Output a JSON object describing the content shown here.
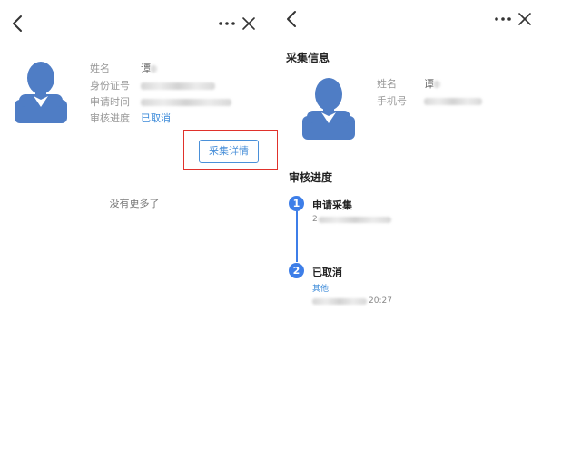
{
  "left_panel": {
    "labels": {
      "name": "姓名",
      "id_number": "身份证号",
      "apply_time": "申请时间",
      "review_progress": "审核进度"
    },
    "values": {
      "name_visible": "谭",
      "review_status": "已取消"
    },
    "detail_button": "采集详情",
    "no_more": "没有更多了"
  },
  "right_panel": {
    "collect_info_title": "采集信息",
    "labels": {
      "name": "姓名",
      "phone": "手机号"
    },
    "values": {
      "name_visible": "谭"
    },
    "review_progress_title": "审核进度",
    "steps": [
      {
        "number": "1",
        "title": "申请采集",
        "time_visible": "2",
        "note": ""
      },
      {
        "number": "2",
        "title": "已取消",
        "note": "其他",
        "time_visible": "20:27"
      }
    ]
  },
  "colors": {
    "accent_blue": "#3d7ee8",
    "link_blue": "#3d8bd9",
    "avatar_blue": "#4f7dc5",
    "highlight_red": "#e0312b"
  },
  "icons": [
    "back-arrow-icon",
    "more-dots-icon",
    "close-x-icon",
    "user-avatar-icon"
  ]
}
